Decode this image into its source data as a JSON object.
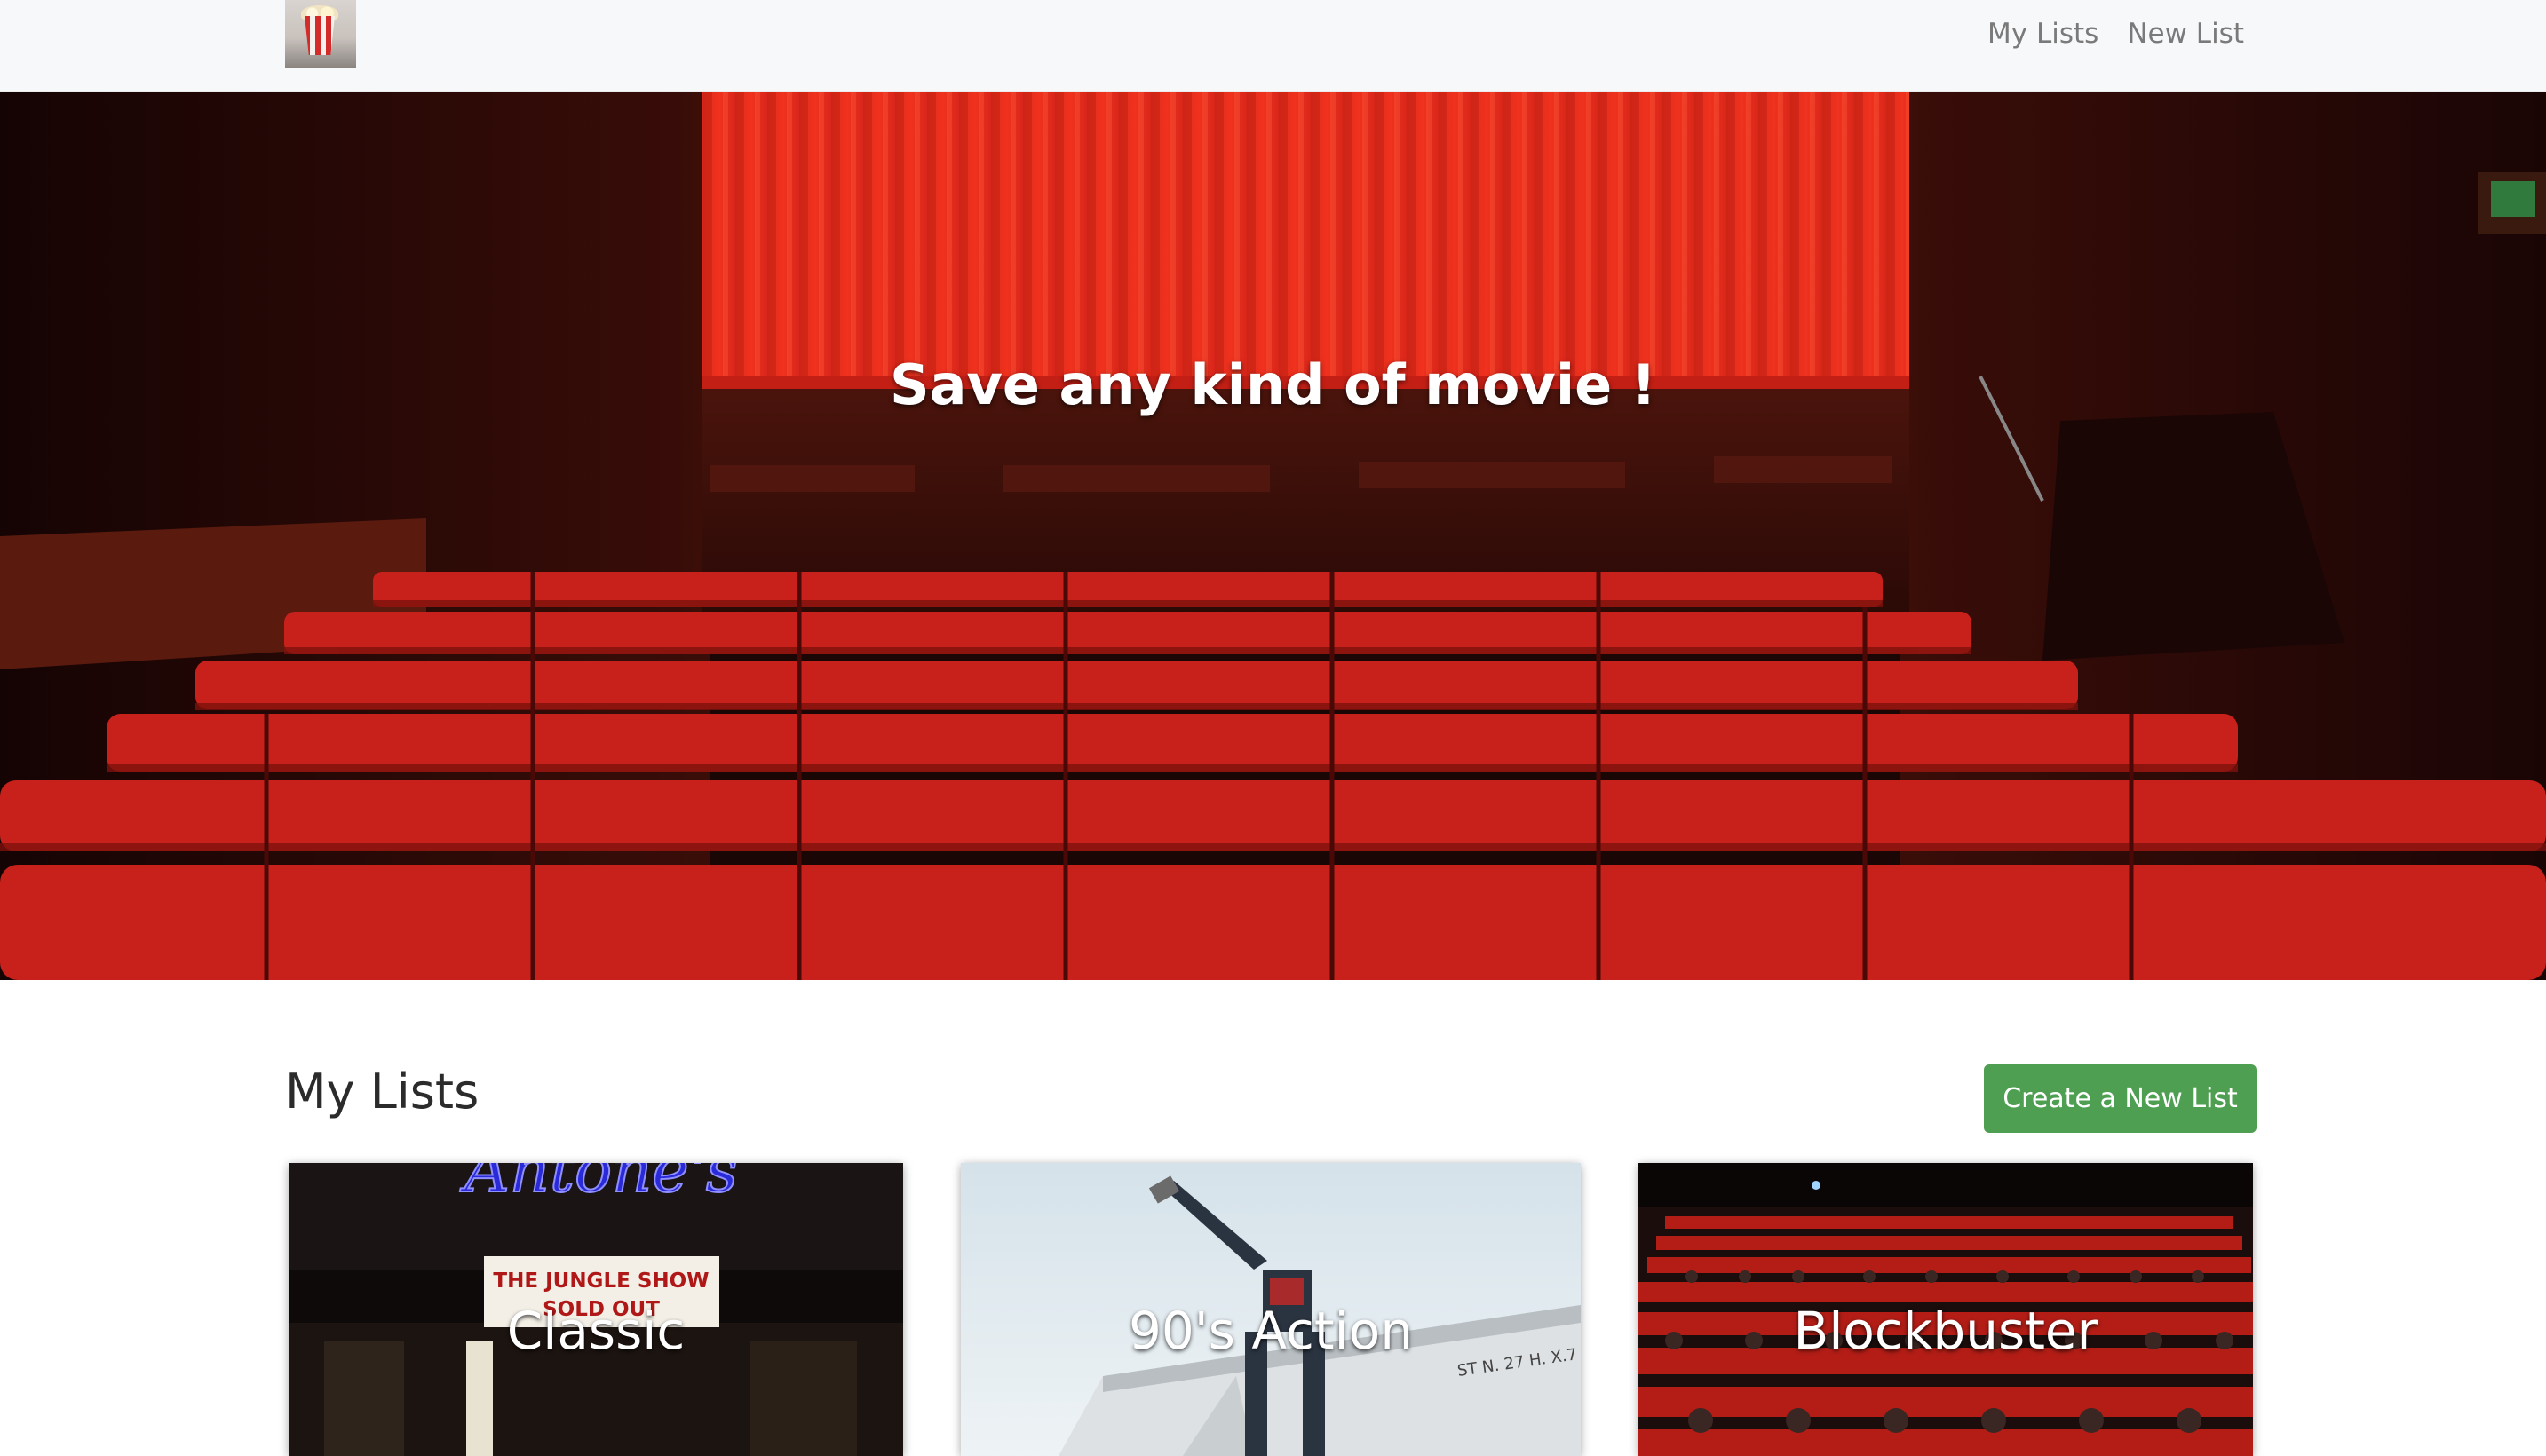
{
  "navbar": {
    "brand_icon": "popcorn-logo",
    "links": [
      "My Lists",
      "New List"
    ]
  },
  "hero": {
    "title": "Save any kind of movie !",
    "image": "cinema-auditorium-red-seats"
  },
  "section": {
    "heading": "My Lists",
    "create_button": "Create a New List"
  },
  "lists": [
    {
      "title": "Classic",
      "image": "antones-marquee",
      "marquee_text": [
        "Antone's",
        "THE JUNGLE SHOW",
        "SOLD OUT"
      ]
    },
    {
      "title": "90's Action",
      "image": "giant-robot-statue",
      "sign_text": "ST N. 27 H. X.7"
    },
    {
      "title": "Blockbuster",
      "image": "packed-cinema-audience"
    }
  ],
  "colors": {
    "navbar_bg": "#f7f8fa",
    "nav_link": "#7a7a7a",
    "button_green": "#4e9f52",
    "curtain_red": "#e62a1c",
    "seat_red": "#c8201a"
  }
}
